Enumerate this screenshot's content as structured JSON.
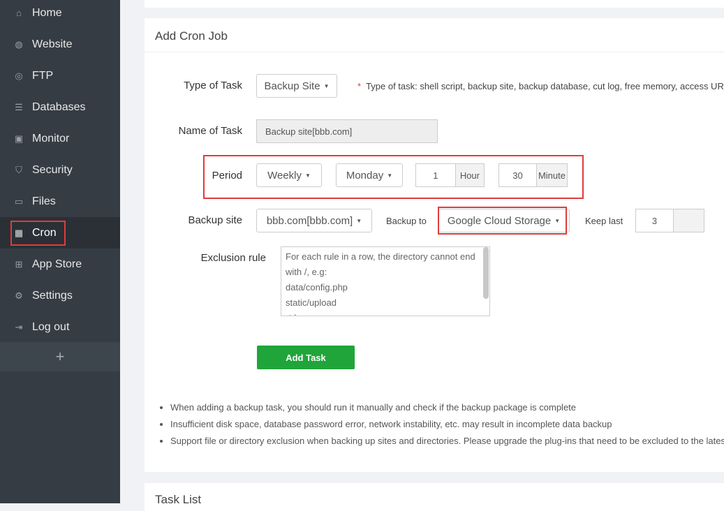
{
  "sidebar": {
    "items": [
      {
        "label": "Home",
        "icon": "home-icon"
      },
      {
        "label": "Website",
        "icon": "globe-icon"
      },
      {
        "label": "FTP",
        "icon": "ftp-icon"
      },
      {
        "label": "Databases",
        "icon": "database-icon"
      },
      {
        "label": "Monitor",
        "icon": "monitor-icon"
      },
      {
        "label": "Security",
        "icon": "shield-icon"
      },
      {
        "label": "Files",
        "icon": "folder-icon"
      },
      {
        "label": "Cron",
        "icon": "calendar-icon"
      },
      {
        "label": "App Store",
        "icon": "grid-icon"
      },
      {
        "label": "Settings",
        "icon": "gear-icon"
      },
      {
        "label": "Log out",
        "icon": "logout-icon"
      }
    ],
    "add": "+"
  },
  "form": {
    "title": "Add Cron Job",
    "type_label": "Type of Task",
    "type_value": "Backup Site",
    "type_hint_star": "*",
    "type_hint": "Type of task: shell script, backup site, backup database, cut log, free memory, access URL",
    "name_label": "Name of Task",
    "name_value": "Backup site[bbb.com]",
    "period_label": "Period",
    "period_value": "Weekly",
    "day_value": "Monday",
    "hour_value": "1",
    "hour_unit": "Hour",
    "minute_value": "30",
    "minute_unit": "Minute",
    "site_label": "Backup site",
    "site_value": "bbb.com[bbb.com]",
    "backup_to_label": "Backup to",
    "backup_to_value": "Google Cloud Storage",
    "keep_label": "Keep last",
    "keep_value": "3",
    "exclusion_label": "Exclusion rule",
    "exclusion_placeholder": "For each rule in a row, the directory cannot end with /, e.g:\ndata/config.php\nstatic/upload\n *.log",
    "submit": "Add Task",
    "notes": [
      "When adding a backup task, you should run it manually and check if the backup package is complete",
      "Insufficient disk space, database password error, network instability, etc. may result in incomplete data backup",
      "Support file or directory exclusion when backing up sites and directories. Please upgrade the plug-ins that need to be excluded to the latest version"
    ]
  },
  "task_list": {
    "title": "Task List"
  }
}
